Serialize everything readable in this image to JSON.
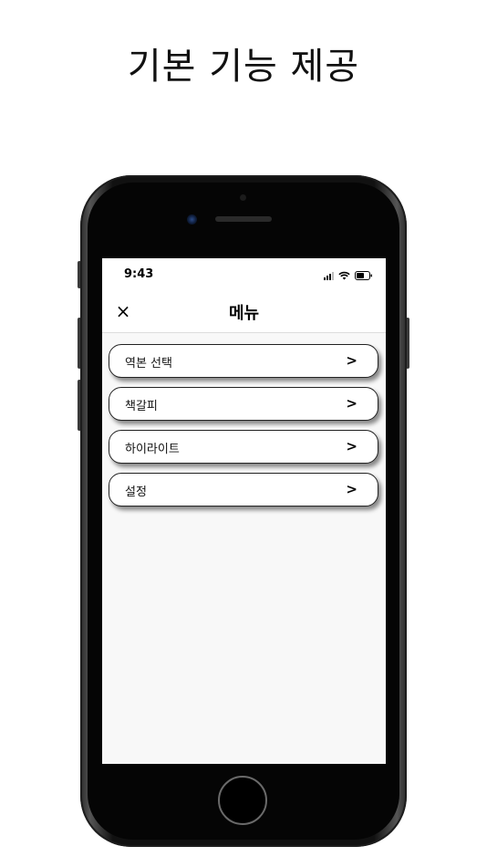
{
  "headline": "기본 기능 제공",
  "status_bar": {
    "time": "9:43",
    "icons": [
      "signal-icon",
      "wifi-icon",
      "battery-icon"
    ]
  },
  "nav": {
    "close_icon": "×",
    "title": "메뉴"
  },
  "menu": {
    "items": [
      {
        "label": "역본 선택",
        "chevron": ">"
      },
      {
        "label": "책갈피",
        "chevron": ">"
      },
      {
        "label": "하이라이트",
        "chevron": ">"
      },
      {
        "label": "설정",
        "chevron": ">"
      }
    ]
  },
  "colors": {
    "screen_bg": "#f8f8f8",
    "phone_body": "#111111",
    "card_bg": "#ffffff",
    "text": "#111111"
  }
}
